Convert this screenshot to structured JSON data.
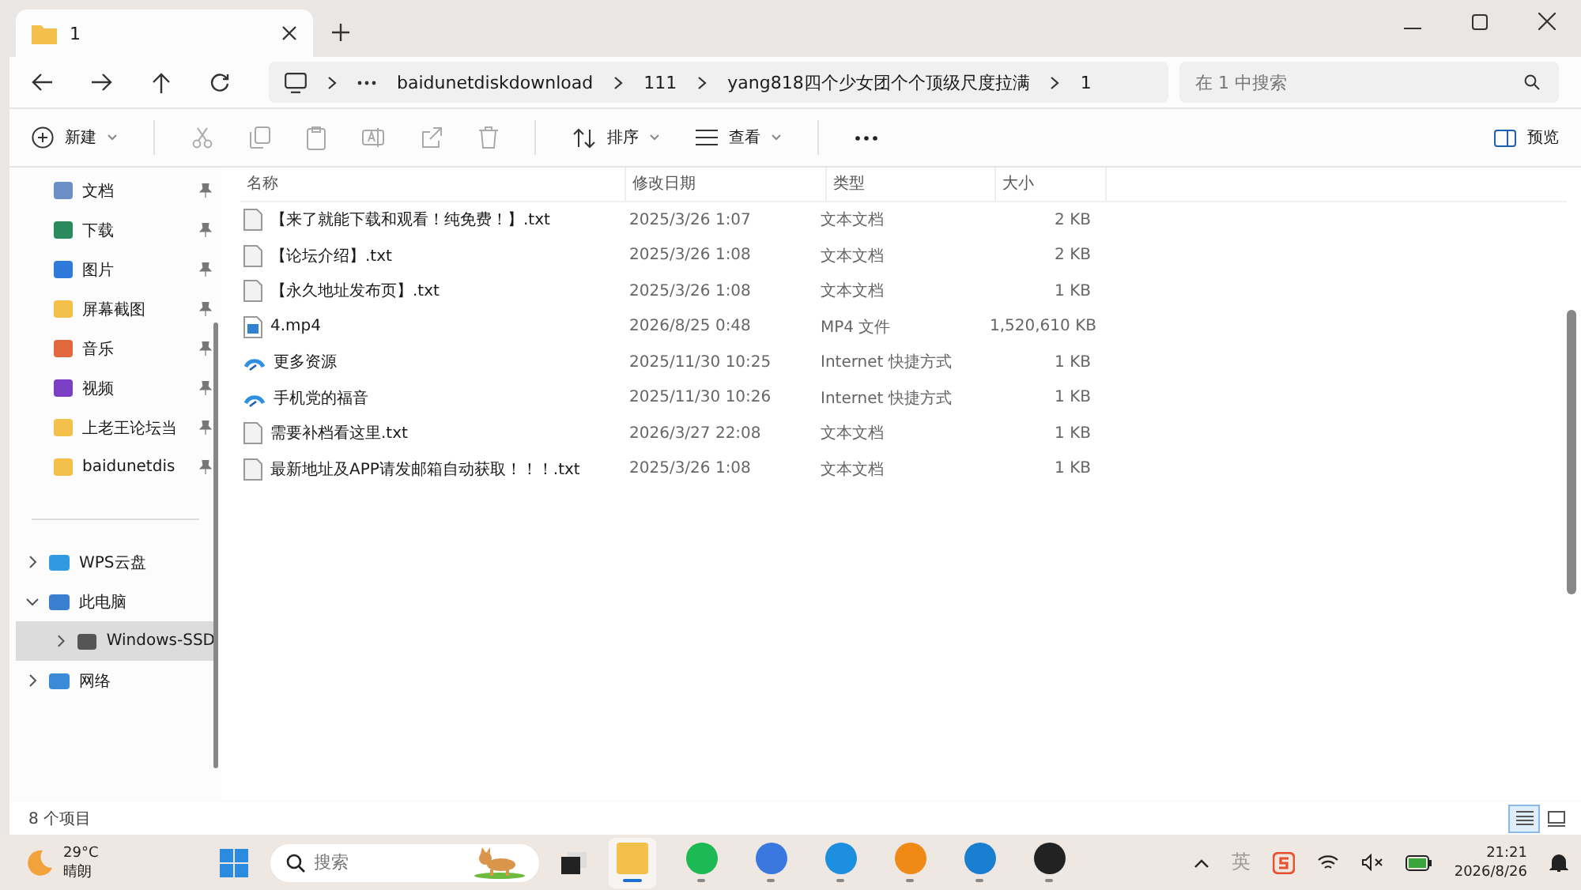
{
  "tabs": [
    {
      "title": "1",
      "selected": true
    }
  ],
  "address": {
    "crumbs": [
      "baidunetdiskdownload",
      "111",
      "yang818四个少女团个个顶级尺度拉满",
      "1"
    ],
    "search": {
      "placeholder": "在 1 中搜索"
    }
  },
  "commands": {
    "new": "新建",
    "sort": "排序",
    "view": "查看",
    "preview": "预览"
  },
  "sidebar": {
    "quick": [
      {
        "label": "文档",
        "kind": "doc",
        "pinned": true
      },
      {
        "label": "下载",
        "kind": "download",
        "pinned": true
      },
      {
        "label": "图片",
        "kind": "picture",
        "pinned": true
      },
      {
        "label": "屏幕截图",
        "kind": "folder",
        "pinned": true
      },
      {
        "label": "音乐",
        "kind": "music",
        "pinned": true
      },
      {
        "label": "视频",
        "kind": "video",
        "pinned": true
      },
      {
        "label": "上老王论坛当",
        "kind": "folder",
        "pinned": true
      },
      {
        "label": "baidunetdis",
        "kind": "folder",
        "pinned": true
      }
    ],
    "tree": [
      {
        "label": "WPS云盘",
        "kind": "cloud",
        "expanded": false,
        "selected": false
      },
      {
        "label": "此电脑",
        "kind": "pc",
        "expanded": true,
        "selected": false,
        "children": [
          {
            "label": "Windows-SSD",
            "kind": "drive",
            "expanded": false,
            "selected": true
          }
        ]
      },
      {
        "label": "网络",
        "kind": "network",
        "expanded": false,
        "selected": false
      }
    ]
  },
  "table": {
    "columns": [
      "名称",
      "修改日期",
      "类型",
      "大小"
    ],
    "rows": [
      {
        "name": "【来了就能下载和观看！纯免费！】.txt",
        "date": "2025/3/26 1:07",
        "type": "文本文档",
        "size": "2 KB",
        "kind": "txt"
      },
      {
        "name": "【论坛介绍】.txt",
        "date": "2025/3/26 1:08",
        "type": "文本文档",
        "size": "2 KB",
        "kind": "txt"
      },
      {
        "name": "【永久地址发布页】.txt",
        "date": "2025/3/26 1:08",
        "type": "文本文档",
        "size": "1 KB",
        "kind": "txt"
      },
      {
        "name": "4.mp4",
        "date": "2026/8/25 0:48",
        "type": "MP4 文件",
        "size": "1,520,610 KB",
        "kind": "video"
      },
      {
        "name": "更多资源",
        "date": "2025/11/30 10:25",
        "type": "Internet 快捷方式",
        "size": "1 KB",
        "kind": "url"
      },
      {
        "name": "手机党的福音",
        "date": "2025/11/30 10:26",
        "type": "Internet 快捷方式",
        "size": "1 KB",
        "kind": "url"
      },
      {
        "name": "需要补档看这里.txt",
        "date": "2026/3/27 22:08",
        "type": "文本文档",
        "size": "1 KB",
        "kind": "txt"
      },
      {
        "name": "最新地址及APP请发邮箱自动获取！！！.txt",
        "date": "2025/3/26 1:08",
        "type": "文本文档",
        "size": "1 KB",
        "kind": "txt"
      }
    ]
  },
  "status_bar": {
    "count": "8 个项目",
    "views": [
      {
        "kind": "details",
        "selected": true
      },
      {
        "kind": "tiles",
        "selected": false
      }
    ]
  },
  "taskbar": {
    "weather": {
      "temp": "29°C",
      "condition": "晴朗"
    },
    "search": {
      "placeholder": "搜索"
    },
    "apps": [
      {
        "kind": "explorer",
        "active": true
      },
      {
        "kind": "green",
        "active": false
      },
      {
        "kind": "cloud",
        "active": false
      },
      {
        "kind": "swirl",
        "active": false
      },
      {
        "kind": "orange",
        "active": false
      },
      {
        "kind": "edge",
        "active": false
      },
      {
        "kind": "penguin",
        "active": false
      }
    ],
    "ime": "英",
    "time": "21:21",
    "date": "2026/8/26"
  }
}
